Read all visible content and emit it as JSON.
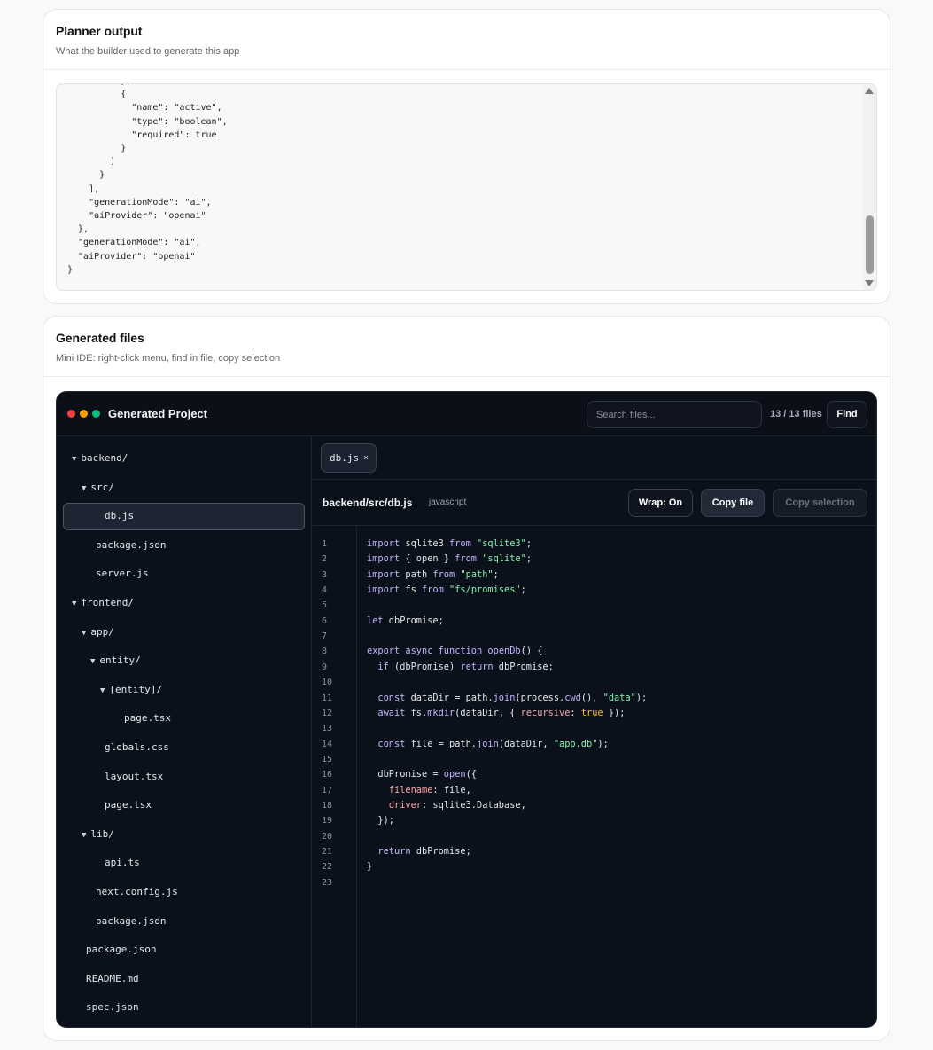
{
  "planner": {
    "title": "Planner output",
    "subtitle": "What the builder used to generate this app",
    "json_lines": [
      "          },",
      "          {",
      "            \"name\": \"active\",",
      "            \"type\": \"boolean\",",
      "            \"required\": true",
      "          }",
      "        ]",
      "      }",
      "    ],",
      "    \"generationMode\": \"ai\",",
      "    \"aiProvider\": \"openai\"",
      "  },",
      "  \"generationMode\": \"ai\",",
      "  \"aiProvider\": \"openai\"",
      "}"
    ]
  },
  "generated": {
    "title": "Generated files",
    "subtitle": "Mini IDE: right-click menu, find in file, copy selection"
  },
  "ide": {
    "project_title": "Generated Project",
    "search_placeholder": "Search files...",
    "file_count": "13 / 13 files",
    "find_label": "Find",
    "tree": [
      {
        "label": "backend/",
        "folder": true,
        "depth": 0
      },
      {
        "label": "src/",
        "folder": true,
        "depth": 1
      },
      {
        "label": "db.js",
        "folder": false,
        "depth": 2,
        "selected": true
      },
      {
        "label": "package.json",
        "folder": false,
        "depth": 1
      },
      {
        "label": "server.js",
        "folder": false,
        "depth": 1
      },
      {
        "label": "frontend/",
        "folder": true,
        "depth": 0
      },
      {
        "label": "app/",
        "folder": true,
        "depth": 1
      },
      {
        "label": "entity/",
        "folder": true,
        "depth": 2
      },
      {
        "label": "[entity]/",
        "folder": true,
        "depth": 3
      },
      {
        "label": "page.tsx",
        "folder": false,
        "depth": 4
      },
      {
        "label": "globals.css",
        "folder": false,
        "depth": 2
      },
      {
        "label": "layout.tsx",
        "folder": false,
        "depth": 2
      },
      {
        "label": "page.tsx",
        "folder": false,
        "depth": 2
      },
      {
        "label": "lib/",
        "folder": true,
        "depth": 1
      },
      {
        "label": "api.ts",
        "folder": false,
        "depth": 2
      },
      {
        "label": "next.config.js",
        "folder": false,
        "depth": 1
      },
      {
        "label": "package.json",
        "folder": false,
        "depth": 1
      },
      {
        "label": "package.json",
        "folder": false,
        "depth": 0
      },
      {
        "label": "README.md",
        "folder": false,
        "depth": 0
      },
      {
        "label": "spec.json",
        "folder": false,
        "depth": 0
      }
    ],
    "open_tab": "db.js",
    "tab_close": "×",
    "file_path": "backend/src/db.js",
    "language": "javascript",
    "wrap_label": "Wrap: On",
    "copy_file_label": "Copy file",
    "copy_selection_label": "Copy selection",
    "code_lines": [
      "import sqlite3 from \"sqlite3\";",
      "import { open } from \"sqlite\";",
      "import path from \"path\";",
      "import fs from \"fs/promises\";",
      "",
      "let dbPromise;",
      "",
      "export async function openDb() {",
      "  if (dbPromise) return dbPromise;",
      "",
      "  const dataDir = path.join(process.cwd(), \"data\");",
      "  await fs.mkdir(dataDir, { recursive: true });",
      "",
      "  const file = path.join(dataDir, \"app.db\");",
      "",
      "  dbPromise = open({",
      "    filename: file,",
      "    driver: sqlite3.Database,",
      "  });",
      "",
      "  return dbPromise;",
      "}",
      ""
    ]
  }
}
